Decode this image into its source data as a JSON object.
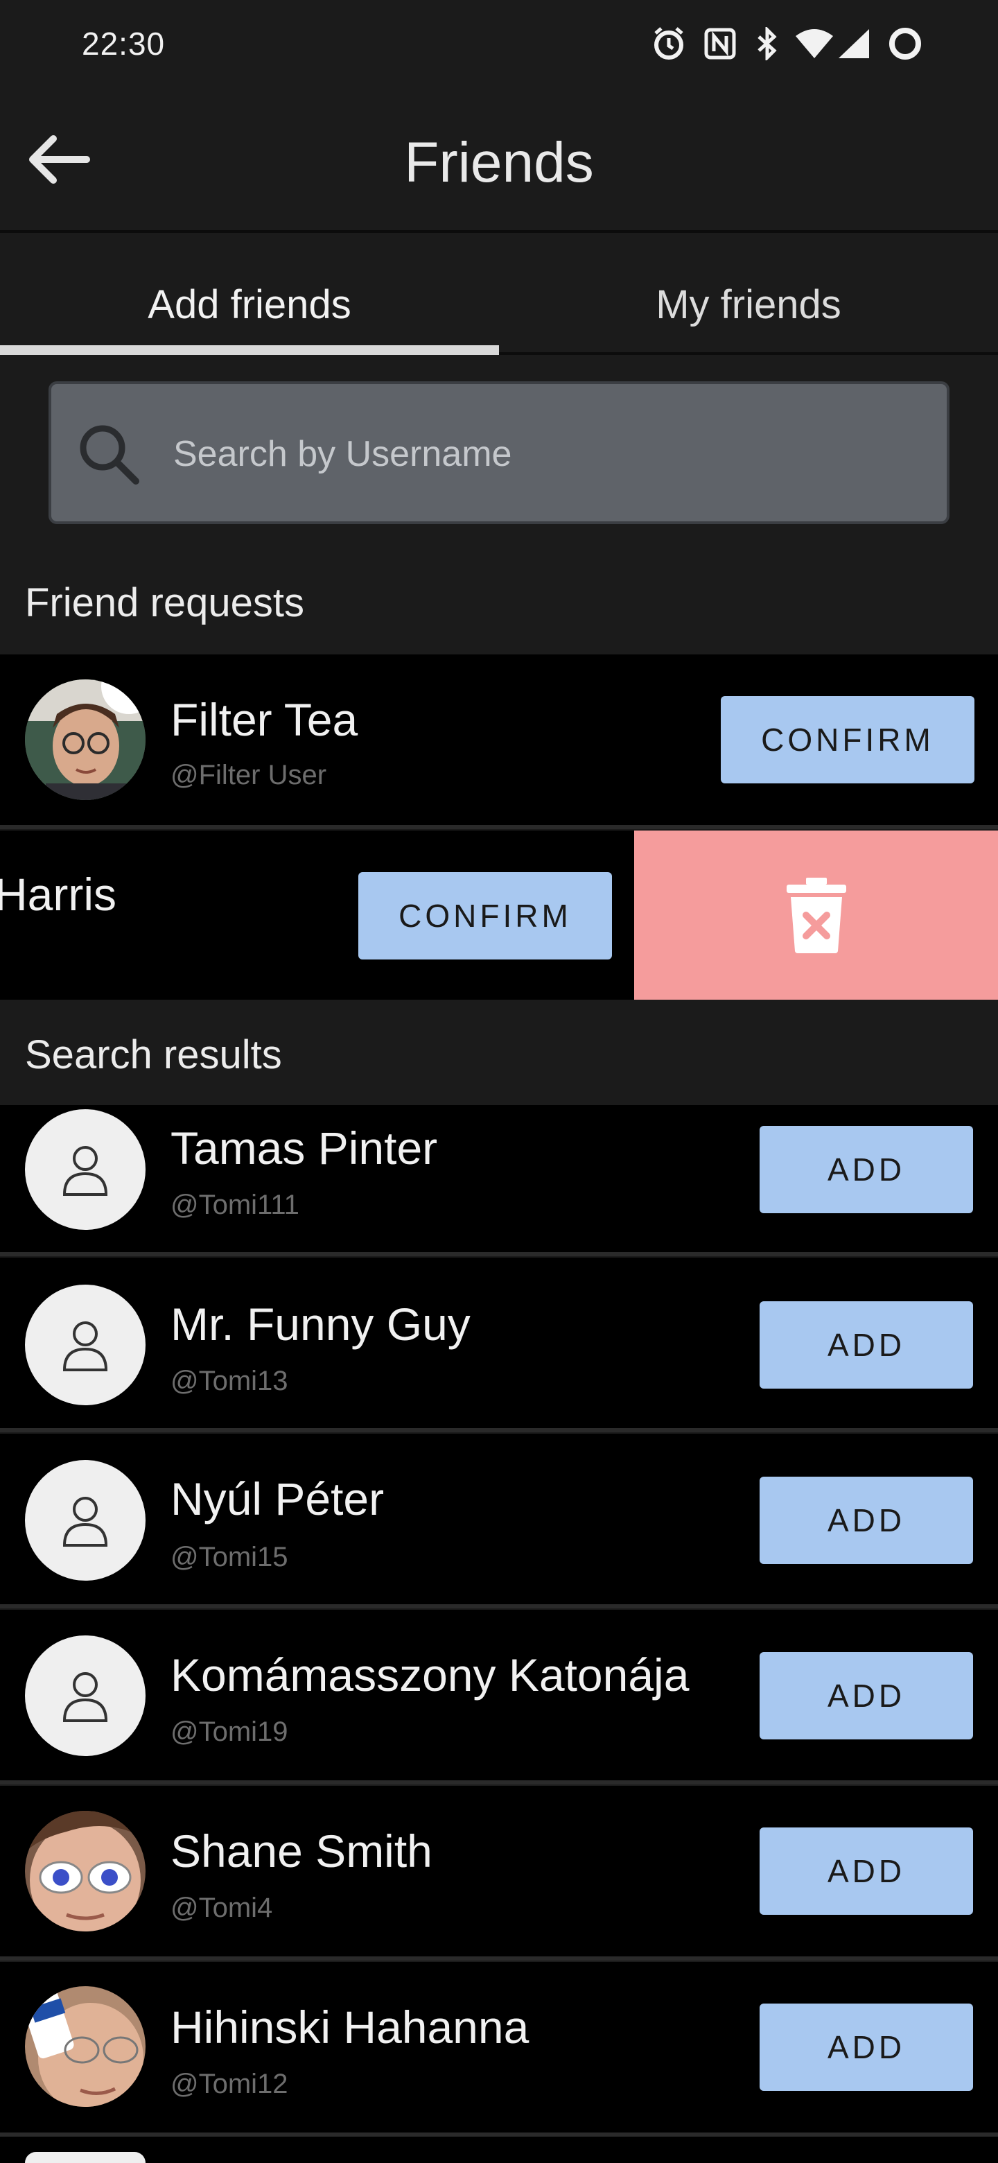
{
  "status_bar": {
    "time": "22:30",
    "icons": [
      "alarm-icon",
      "nfc-icon",
      "bluetooth-icon",
      "wifi-icon",
      "signal-icon",
      "battery-ring-icon"
    ]
  },
  "header": {
    "title": "Friends",
    "back_icon": "arrow-left-icon"
  },
  "tabs": [
    {
      "label": "Add friends",
      "active": true
    },
    {
      "label": "My friends",
      "active": false
    }
  ],
  "search": {
    "placeholder": "Search by Username",
    "value": ""
  },
  "friend_requests": {
    "heading": "Friend requests",
    "items": [
      {
        "name": "Filter Tea",
        "handle": "@Filter User",
        "button": "CONFIRM",
        "avatar": "photo"
      },
      {
        "name": "Harris",
        "button": "CONFIRM",
        "swipe_action": "delete",
        "swipe_icon": "trash-x-icon"
      }
    ]
  },
  "search_results": {
    "heading": "Search results",
    "items": [
      {
        "name": "Tamas Pinter",
        "handle": "@Tomi111",
        "button": "ADD",
        "avatar": "default"
      },
      {
        "name": "Mr. Funny Guy",
        "handle": "@Tomi13",
        "button": "ADD",
        "avatar": "default"
      },
      {
        "name": "Nyúl Péter",
        "handle": "@Tomi15",
        "button": "ADD",
        "avatar": "default"
      },
      {
        "name": "Komámasszony Katonája",
        "handle": "@Tomi19",
        "button": "ADD",
        "avatar": "default"
      },
      {
        "name": "Shane Smith",
        "handle": "@Tomi4",
        "button": "ADD",
        "avatar": "photo"
      },
      {
        "name": "Hihinski Hahanna",
        "handle": "@Tomi12",
        "button": "ADD",
        "avatar": "photo"
      }
    ]
  },
  "colors": {
    "background": "#1b1b1b",
    "row": "#000000",
    "button": "#a8c8f0",
    "delete": "#f59c9c",
    "search_field": "#5f6369"
  }
}
